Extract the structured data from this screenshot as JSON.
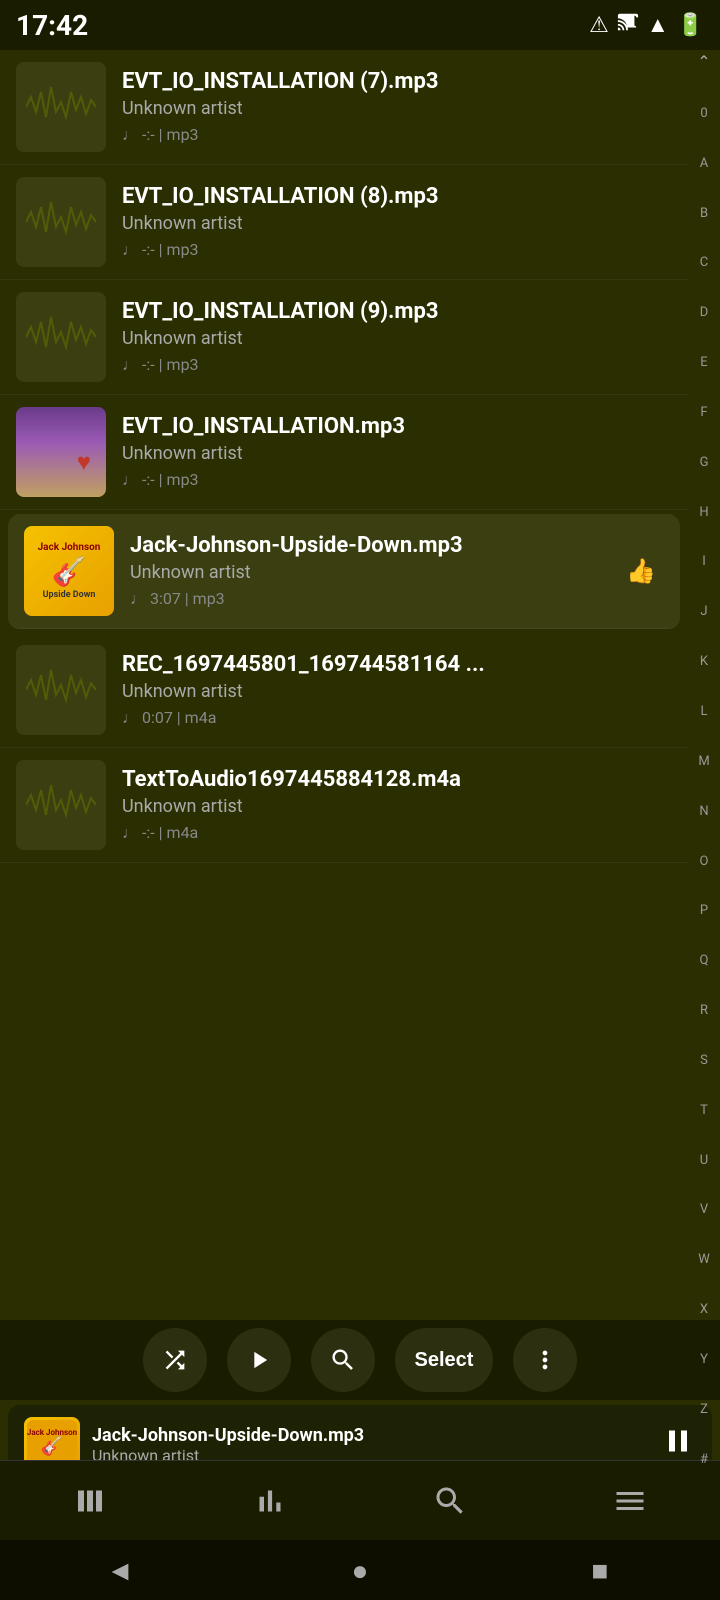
{
  "statusBar": {
    "time": "17:42",
    "notificationIcon": "!",
    "castIcon": "cast",
    "wifiIcon": "wifi",
    "batteryIcon": "battery"
  },
  "songs": [
    {
      "id": 1,
      "title": "EVT_IO_INSTALLATION (7).mp3",
      "artist": "Unknown artist",
      "duration": "-:-",
      "format": "mp3",
      "meta": "♩ -:- | mp3",
      "artType": "waveform",
      "active": false
    },
    {
      "id": 2,
      "title": "EVT_IO_INSTALLATION (8).mp3",
      "artist": "Unknown artist",
      "duration": "-:-",
      "format": "mp3",
      "meta": "♩ -:- | mp3",
      "artType": "waveform",
      "active": false
    },
    {
      "id": 3,
      "title": "EVT_IO_INSTALLATION (9).mp3",
      "artist": "Unknown artist",
      "duration": "-:-",
      "format": "mp3",
      "meta": "♩ -:- | mp3",
      "artType": "waveform",
      "active": false
    },
    {
      "id": 4,
      "title": "EVT_IO_INSTALLATION.mp3",
      "artist": "Unknown artist",
      "duration": "-:-",
      "format": "mp3",
      "meta": "♩ -:- | mp3",
      "artType": "evt",
      "active": false
    },
    {
      "id": 5,
      "title": "Jack-Johnson-Upside-Down.mp3",
      "artist": "Unknown artist",
      "duration": "3:07",
      "format": "mp3",
      "meta": "♩ 3:07 | mp3",
      "artType": "jj",
      "active": true
    },
    {
      "id": 6,
      "title": "REC_1697445801_169744581164 ...",
      "artist": "Unknown artist",
      "duration": "0:07",
      "format": "m4a",
      "meta": "♩ 0:07 | m4a",
      "artType": "waveform",
      "active": false
    },
    {
      "id": 7,
      "title": "TextToAudio1697445884128.m4a",
      "artist": "Unknown artist",
      "duration": "-:-",
      "format": "m4a",
      "meta": "♩ -:- | m4a",
      "artType": "waveform",
      "active": false
    }
  ],
  "alphabet": [
    "↑",
    "0",
    "A",
    "B",
    "C",
    "D",
    "E",
    "F",
    "G",
    "H",
    "I",
    "J",
    "K",
    "L",
    "M",
    "N",
    "O",
    "P",
    "Q",
    "R",
    "S",
    "T",
    "U",
    "V",
    "W",
    "X",
    "Y",
    "Z",
    "#"
  ],
  "toolbar": {
    "shuffle": "⇌",
    "play": "▶",
    "search": "🔍",
    "select": "Select",
    "more": "⋮"
  },
  "nowPlaying": {
    "title": "Jack-Johnson-Upside-Down.mp3",
    "artist": "Unknown artist",
    "isPlaying": true
  },
  "bottomNav": {
    "library": "⊞",
    "stats": "📊",
    "search": "🔍",
    "menu": "☰"
  },
  "systemNav": {
    "back": "◄",
    "home": "●",
    "recent": "■"
  }
}
